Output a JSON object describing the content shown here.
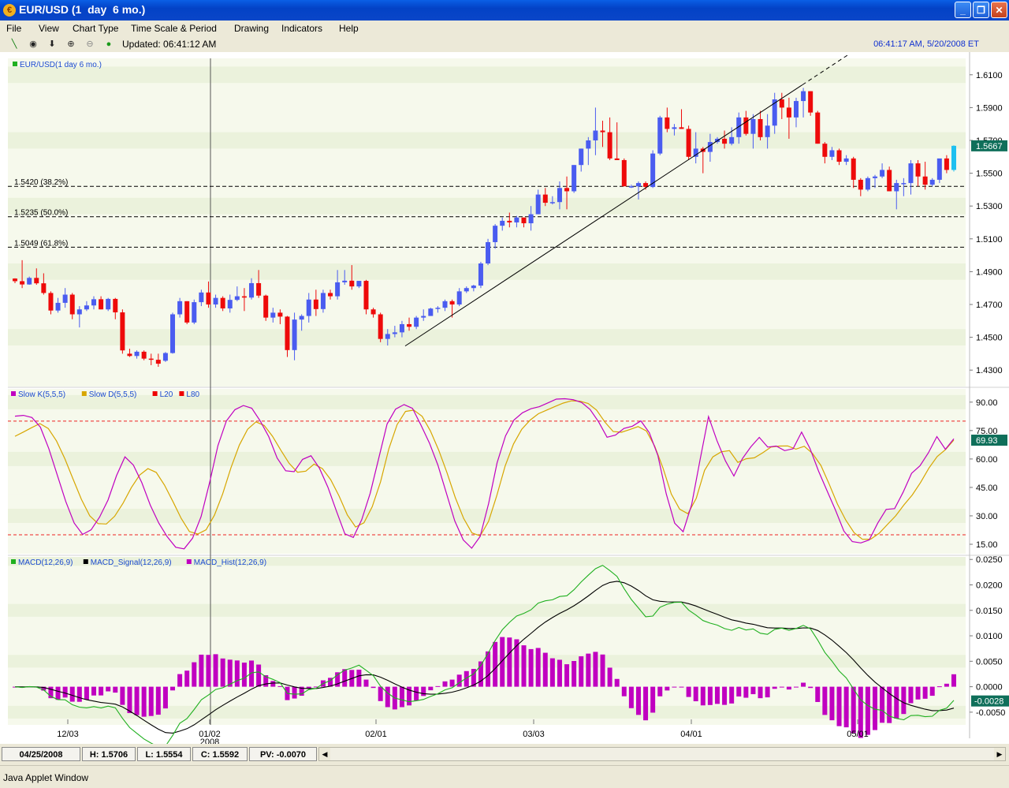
{
  "window": {
    "title": "EUR/USD (1  day  6 mo.)",
    "minimize_icon": "minimize-icon",
    "maximize_icon": "maximize-icon",
    "close_icon": "close-icon"
  },
  "menu": [
    "File",
    "View",
    "Chart Type",
    "Time Scale & Period",
    "Drawing",
    "Indicators",
    "Help"
  ],
  "toolbar": {
    "icons": [
      "line-tool-icon",
      "target-icon",
      "arrow-down-icon",
      "zoom-in-icon",
      "zoom-out-icon",
      "dot-icon"
    ],
    "updated": "Updated: 06:41:12 AM",
    "clock": "06:41:17 AM, 5/20/2008 ET"
  },
  "status": {
    "date": "04/25/2008",
    "high": "H: 1.5706",
    "low": "L: 1.5554",
    "close": "C: 1.5592",
    "pv": "PV: -0.0070"
  },
  "applet_label": "Java Applet Window",
  "colors": {
    "up": "#4a5cf0",
    "down": "#ee0a0a",
    "last": "#1ec0f0",
    "k": "#c000c0",
    "d": "#d7a600",
    "macd": "#20b020",
    "signal": "#000000",
    "hist": "#c000c0",
    "band_light": "#f6f9ec",
    "band_dark": "#ebf2dc"
  },
  "chart_data": [
    {
      "type": "candlestick",
      "title": "EUR/USD(1 day 6 mo.)",
      "ylim": [
        1.42,
        1.62
      ],
      "yticks": [
        "1.6100",
        "1.5900",
        "1.5700",
        "1.5500",
        "1.5300",
        "1.5100",
        "1.4900",
        "1.4700",
        "1.4500",
        "1.4300"
      ],
      "x_labels": [
        "12/03",
        "01/02",
        "02/01",
        "03/03",
        "04/01",
        "05/01"
      ],
      "x_sublabel": "2008",
      "last_price": "1.5667",
      "fib_levels": [
        {
          "value": 1.542,
          "label": "1.5420 (38.2%)"
        },
        {
          "value": 1.5235,
          "label": "1.5235 (50.0%)"
        },
        {
          "value": 1.5049,
          "label": "1.5049 (61.8%)"
        }
      ],
      "trendline": [
        [
          1.4447,
          1.6039
        ]
      ],
      "candles": [
        [
          1.4858,
          1.486,
          1.483,
          1.4842
        ],
        [
          1.4842,
          1.497,
          1.48,
          1.4822
        ],
        [
          1.4822,
          1.487,
          1.482,
          1.4862
        ],
        [
          1.4862,
          1.492,
          1.482,
          1.4829
        ],
        [
          1.4829,
          1.489,
          1.476,
          1.477
        ],
        [
          1.477,
          1.478,
          1.464,
          1.4663
        ],
        [
          1.4663,
          1.474,
          1.465,
          1.471
        ],
        [
          1.471,
          1.48,
          1.468,
          1.476
        ],
        [
          1.476,
          1.477,
          1.461,
          1.464
        ],
        [
          1.464,
          1.469,
          1.456,
          1.467
        ],
        [
          1.467,
          1.472,
          1.466,
          1.4694
        ],
        [
          1.4694,
          1.475,
          1.467,
          1.4732
        ],
        [
          1.4732,
          1.475,
          1.467,
          1.467
        ],
        [
          1.467,
          1.474,
          1.466,
          1.4734
        ],
        [
          1.4734,
          1.474,
          1.461,
          1.4652
        ],
        [
          1.4652,
          1.467,
          1.44,
          1.442
        ],
        [
          1.44,
          1.443,
          1.438,
          1.4386
        ],
        [
          1.4386,
          1.442,
          1.437,
          1.4412
        ],
        [
          1.4412,
          1.442,
          1.436,
          1.437
        ],
        [
          1.437,
          1.44,
          1.433,
          1.4363
        ],
        [
          1.4363,
          1.44,
          1.432,
          1.4339
        ],
        [
          1.4357,
          1.441,
          1.435,
          1.4404
        ],
        [
          1.4404,
          1.465,
          1.44,
          1.464
        ],
        [
          1.464,
          1.474,
          1.462,
          1.472
        ],
        [
          1.472,
          1.472,
          1.458,
          1.459
        ],
        [
          1.459,
          1.473,
          1.458,
          1.4714
        ],
        [
          1.4714,
          1.479,
          1.469,
          1.4773
        ],
        [
          1.4773,
          1.484,
          1.468,
          1.47
        ],
        [
          1.47,
          1.476,
          1.468,
          1.474
        ],
        [
          1.474,
          1.475,
          1.466,
          1.4676
        ],
        [
          1.4676,
          1.476,
          1.465,
          1.4728
        ],
        [
          1.4728,
          1.481,
          1.472,
          1.475
        ],
        [
          1.475,
          1.48,
          1.466,
          1.4742
        ],
        [
          1.4742,
          1.486,
          1.473,
          1.483
        ],
        [
          1.483,
          1.491,
          1.474,
          1.4754
        ],
        [
          1.4754,
          1.476,
          1.46,
          1.462
        ],
        [
          1.462,
          1.468,
          1.459,
          1.465
        ],
        [
          1.465,
          1.467,
          1.458,
          1.4626
        ],
        [
          1.4626,
          1.463,
          1.438,
          1.4422
        ],
        [
          1.4422,
          1.465,
          1.436,
          1.4608
        ],
        [
          1.4608,
          1.464,
          1.454,
          1.463
        ],
        [
          1.463,
          1.477,
          1.459,
          1.473
        ],
        [
          1.473,
          1.479,
          1.463,
          1.4672
        ],
        [
          1.4672,
          1.479,
          1.465,
          1.477
        ],
        [
          1.477,
          1.479,
          1.473,
          1.475
        ],
        [
          1.475,
          1.491,
          1.473,
          1.4835
        ],
        [
          1.4835,
          1.491,
          1.482,
          1.4845
        ],
        [
          1.4845,
          1.494,
          1.479,
          1.481
        ],
        [
          1.481,
          1.484,
          1.48,
          1.4844
        ],
        [
          1.4844,
          1.485,
          1.464,
          1.467
        ],
        [
          1.467,
          1.468,
          1.462,
          1.464
        ],
        [
          1.464,
          1.465,
          1.447,
          1.449
        ],
        [
          1.449,
          1.455,
          1.445,
          1.452
        ],
        [
          1.452,
          1.457,
          1.45,
          1.453
        ],
        [
          1.453,
          1.46,
          1.45,
          1.458
        ],
        [
          1.458,
          1.462,
          1.454,
          1.4564
        ],
        [
          1.4564,
          1.463,
          1.455,
          1.462
        ],
        [
          1.462,
          1.467,
          1.46,
          1.463
        ],
        [
          1.463,
          1.468,
          1.463,
          1.4675
        ],
        [
          1.4675,
          1.469,
          1.465,
          1.468
        ],
        [
          1.468,
          1.473,
          1.466,
          1.472
        ],
        [
          1.472,
          1.473,
          1.462,
          1.47
        ],
        [
          1.47,
          1.48,
          1.469,
          1.478
        ],
        [
          1.478,
          1.481,
          1.477,
          1.48
        ],
        [
          1.48,
          1.482,
          1.478,
          1.4815
        ],
        [
          1.4815,
          1.496,
          1.48,
          1.495
        ],
        [
          1.495,
          1.51,
          1.494,
          1.508
        ],
        [
          1.508,
          1.519,
          1.504,
          1.518
        ],
        [
          1.518,
          1.523,
          1.515,
          1.521
        ],
        [
          1.521,
          1.526,
          1.517,
          1.52
        ],
        [
          1.52,
          1.524,
          1.517,
          1.523
        ],
        [
          1.523,
          1.523,
          1.517,
          1.5195
        ],
        [
          1.5195,
          1.53,
          1.515,
          1.525
        ],
        [
          1.525,
          1.54,
          1.525,
          1.537
        ],
        [
          1.537,
          1.541,
          1.53,
          1.532
        ],
        [
          1.532,
          1.536,
          1.531,
          1.5324
        ],
        [
          1.5324,
          1.545,
          1.528,
          1.541
        ],
        [
          1.541,
          1.548,
          1.528,
          1.539
        ],
        [
          1.539,
          1.555,
          1.538,
          1.555
        ],
        [
          1.555,
          1.565,
          1.551,
          1.565
        ],
        [
          1.565,
          1.572,
          1.555,
          1.57
        ],
        [
          1.57,
          1.59,
          1.561,
          1.576
        ],
        [
          1.576,
          1.582,
          1.566,
          1.575
        ],
        [
          1.575,
          1.584,
          1.558,
          1.559
        ],
        [
          1.559,
          1.581,
          1.558,
          1.558
        ],
        [
          1.558,
          1.559,
          1.543,
          1.542
        ],
        [
          1.542,
          1.543,
          1.541,
          1.542
        ],
        [
          1.542,
          1.545,
          1.534,
          1.544
        ],
        [
          1.544,
          1.545,
          1.54,
          1.5416
        ],
        [
          1.5416,
          1.564,
          1.541,
          1.562
        ],
        [
          1.562,
          1.585,
          1.561,
          1.584
        ],
        [
          1.584,
          1.59,
          1.575,
          1.577
        ],
        [
          1.577,
          1.58,
          1.573,
          1.578
        ],
        [
          1.578,
          1.589,
          1.577,
          1.577
        ],
        [
          1.577,
          1.579,
          1.558,
          1.56
        ],
        [
          1.56,
          1.575,
          1.556,
          1.565
        ],
        [
          1.565,
          1.566,
          1.55,
          1.563
        ],
        [
          1.563,
          1.574,
          1.557,
          1.569
        ],
        [
          1.569,
          1.572,
          1.568,
          1.571
        ],
        [
          1.571,
          1.576,
          1.565,
          1.568
        ],
        [
          1.568,
          1.578,
          1.567,
          1.572
        ],
        [
          1.572,
          1.587,
          1.568,
          1.584
        ],
        [
          1.584,
          1.588,
          1.573,
          1.574
        ],
        [
          1.574,
          1.586,
          1.565,
          1.583
        ],
        [
          1.583,
          1.588,
          1.57,
          1.572
        ],
        [
          1.572,
          1.586,
          1.565,
          1.579
        ],
        [
          1.579,
          1.599,
          1.574,
          1.595
        ],
        [
          1.595,
          1.599,
          1.583,
          1.59
        ],
        [
          1.59,
          1.596,
          1.571,
          1.584
        ],
        [
          1.584,
          1.596,
          1.578,
          1.594
        ],
        [
          1.594,
          1.602,
          1.584,
          1.6
        ],
        [
          1.6,
          1.6,
          1.585,
          1.587
        ],
        [
          1.587,
          1.588,
          1.568,
          1.568
        ],
        [
          1.568,
          1.569,
          1.556,
          1.56
        ],
        [
          1.56,
          1.566,
          1.558,
          1.564
        ],
        [
          1.564,
          1.565,
          1.555,
          1.557
        ],
        [
          1.557,
          1.561,
          1.555,
          1.559
        ],
        [
          1.559,
          1.56,
          1.541,
          1.546
        ],
        [
          1.546,
          1.547,
          1.536,
          1.54
        ],
        [
          1.54,
          1.548,
          1.539,
          1.547
        ],
        [
          1.547,
          1.549,
          1.541,
          1.548
        ],
        [
          1.548,
          1.556,
          1.547,
          1.552
        ],
        [
          1.552,
          1.554,
          1.539,
          1.539
        ],
        [
          1.539,
          1.546,
          1.528,
          1.544
        ],
        [
          1.544,
          1.547,
          1.536,
          1.544
        ],
        [
          1.544,
          1.558,
          1.537,
          1.556
        ],
        [
          1.556,
          1.558,
          1.542,
          1.548
        ],
        [
          1.548,
          1.557,
          1.54,
          1.543
        ],
        [
          1.543,
          1.547,
          1.542,
          1.546
        ],
        [
          1.546,
          1.558,
          1.544,
          1.559
        ],
        [
          1.559,
          1.561,
          1.55,
          1.552
        ],
        [
          1.552,
          1.567,
          1.551,
          1.5667
        ]
      ]
    },
    {
      "type": "line",
      "series_labels": [
        {
          "name": "Slow K(5,5,5)",
          "color": "#c000c0"
        },
        {
          "name": "Slow D(5,5,5)",
          "color": "#d7a600"
        },
        {
          "name": "L20",
          "color": "#ee0000"
        },
        {
          "name": "L80",
          "color": "#ee0000"
        }
      ],
      "ylim": [
        10,
        97
      ],
      "yticks": [
        "90.00",
        "75.00",
        "60.00",
        "45.00",
        "30.00",
        "15.00"
      ],
      "last_value": "69.93",
      "levels": [
        20,
        80
      ],
      "k": [
        82.6,
        83.0,
        81.9,
        76.8,
        65.5,
        51.6,
        37.6,
        26.2,
        20.2,
        22.6,
        29.3,
        38.3,
        51.2,
        61.1,
        56.8,
        47.5,
        35.6,
        26.2,
        19.0,
        13.4,
        12.6,
        18.2,
        29.6,
        47.4,
        67.1,
        80.1,
        86.0,
        88.2,
        86.8,
        80.0,
        71.8,
        60.5,
        53.8,
        53.3,
        59.8,
        61.7,
        55.1,
        45.1,
        32.6,
        20.5,
        18.6,
        28.0,
        41.9,
        60.3,
        78.5,
        86.3,
        88.7,
        86.7,
        77.9,
        68.4,
        56.8,
        42.1,
        27.3,
        17.3,
        12.9,
        19.1,
        36.6,
        58.0,
        72.2,
        80.6,
        84.4,
        86.5,
        87.6,
        89.6,
        91.6,
        91.8,
        91.3,
        89.8,
        86.1,
        79.6,
        71.5,
        72.6,
        76.1,
        77.3,
        80.1,
        73.9,
        61.9,
        41.6,
        26.1,
        21.6,
        35.9,
        59.6,
        82.4,
        69.6,
        59.0,
        51.0,
        60.2,
        66.4,
        71.4,
        66.3,
        66.8,
        64.4,
        65.4,
        74.2,
        65.5,
        53.7,
        43.3,
        33.1,
        22.0,
        16.4,
        15.7,
        17.3,
        26.1,
        33.4,
        33.8,
        42.4,
        52.4,
        56.4,
        63.3,
        71.8,
        65.1,
        70.7
      ],
      "d": [
        72.0,
        74.2,
        76.5,
        78.7,
        76.1,
        69.5,
        60.2,
        49.3,
        38.7,
        30.0,
        25.9,
        25.7,
        29.8,
        36.6,
        44.9,
        51.5,
        54.9,
        52.9,
        46.2,
        37.6,
        28.7,
        21.7,
        20.4,
        22.6,
        30.3,
        41.6,
        55.4,
        67.3,
        75.7,
        79.6,
        77.7,
        72.0,
        64.6,
        57.7,
        53.0,
        53.6,
        57.3,
        54.9,
        49.1,
        40.5,
        30.5,
        24.1,
        26.3,
        34.8,
        48.0,
        65.4,
        78.2,
        85.1,
        85.8,
        82.5,
        74.8,
        64.7,
        52.7,
        39.6,
        28.6,
        21.0,
        19.4,
        27.1,
        40.8,
        56.3,
        67.9,
        75.7,
        80.5,
        83.9,
        85.8,
        87.7,
        89.5,
        90.7,
        90.5,
        89.3,
        85.8,
        79.5,
        74.5,
        74.1,
        75.5,
        77.1,
        74.8,
        66.7,
        55.2,
        41.5,
        33.5,
        31.1,
        39.3,
        54.0,
        61.1,
        63.8,
        64.4,
        58.2,
        60.1,
        60.6,
        63.3,
        66.3,
        66.8,
        66.9,
        65.2,
        66.7,
        62.9,
        56.6,
        46.7,
        36.2,
        27.7,
        21.1,
        17.6,
        17.7,
        20.7,
        25.4,
        30.0,
        35.8,
        41.0,
        47.6,
        55.2,
        61.3,
        65.0,
        70.0
      ]
    },
    {
      "type": "line+bar",
      "series_labels": [
        {
          "name": "MACD(12,26,9)",
          "color": "#20b020"
        },
        {
          "name": "MACD_Signal(12,26,9)",
          "color": "#000000"
        },
        {
          "name": "MACD_Hist(12,26,9)",
          "color": "#c000c0"
        }
      ],
      "ylim": [
        -0.0075,
        0.0255
      ],
      "yticks": [
        "0.0250",
        "0.0200",
        "0.0150",
        "0.0100",
        "0.0050",
        "0.0000",
        "-0.0050"
      ],
      "last_value": "-0.0028"
    }
  ]
}
